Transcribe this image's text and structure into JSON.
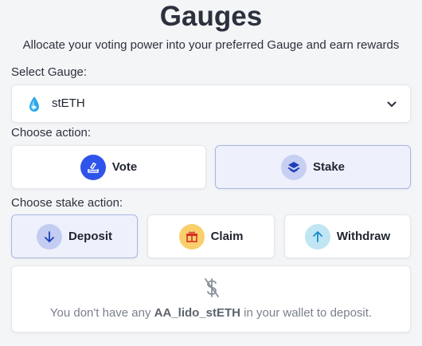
{
  "header": {
    "title": "Gauges",
    "subtitle": "Allocate your voting power into your preferred Gauge and earn rewards"
  },
  "gauge_select": {
    "label": "Select Gauge:",
    "selected_value": "stETH",
    "icon": "steth-droplet-icon"
  },
  "action": {
    "label": "Choose action:",
    "options": [
      {
        "label": "Vote",
        "icon": "ballot-box-icon",
        "selected": false
      },
      {
        "label": "Stake",
        "icon": "layers-icon",
        "selected": true
      }
    ]
  },
  "stake_action": {
    "label": "Choose stake action:",
    "options": [
      {
        "label": "Deposit",
        "icon": "arrow-down-icon",
        "selected": true
      },
      {
        "label": "Claim",
        "icon": "gift-icon",
        "selected": false
      },
      {
        "label": "Withdraw",
        "icon": "arrow-up-icon",
        "selected": false
      }
    ]
  },
  "empty_state": {
    "icon": "no-dollar-icon",
    "text_before": "You don't have any ",
    "token": "AA_lido_stETH",
    "text_after": " in your wallet to deposit."
  },
  "colors": {
    "accent": "#3b5bdb",
    "selected_bg": "#eef1fb",
    "vote_circle": "#2f54eb",
    "stake_circle": "#c7d0f2",
    "deposit_circle": "#c3cdf2",
    "claim_circle": "#f9cf6c",
    "withdraw_circle": "#bfe6f2"
  }
}
